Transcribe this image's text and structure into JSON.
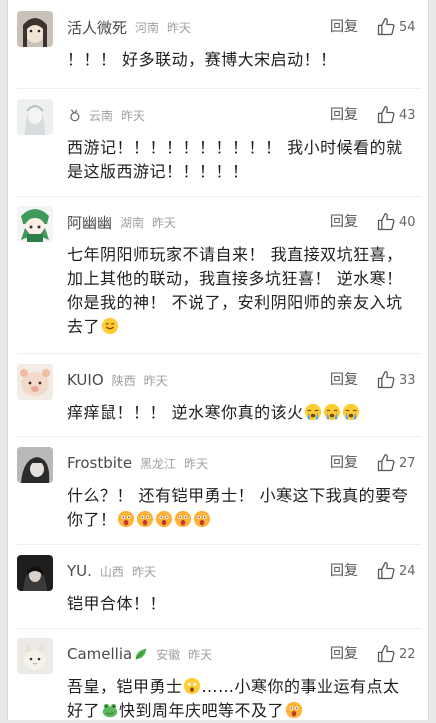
{
  "comments": [
    {
      "username": "活人微死",
      "location": "河南",
      "time": "昨天",
      "reply": "回复",
      "likes": "54",
      "lines": [
        "！！！ 好多联动，赛博大宋启动！！"
      ]
    },
    {
      "username": "",
      "location": "云南",
      "time": "昨天",
      "reply": "回复",
      "likes": "43",
      "lines": [
        "西游记！！！！！！！！！！ 我小时候看的就",
        "是这版西游记！！！！！"
      ]
    },
    {
      "username": "阿幽幽",
      "location": "湖南",
      "time": "昨天",
      "reply": "回复",
      "likes": "40",
      "lines": [
        "七年阴阳师玩家不请自来！ 我直接双坑狂喜，",
        "加上其他的联动，我直接多坑狂喜！ 逆水寒！",
        "你是我的神！ 不说了，安利阴阳师的亲友入坑",
        "去了"
      ]
    },
    {
      "username": "KUIO",
      "location": "陕西",
      "time": "昨天",
      "reply": "回复",
      "likes": "33",
      "lines": [
        "痒痒鼠！！！ 逆水寒你真的该火"
      ]
    },
    {
      "username": "Frostbite",
      "location": "黑龙江",
      "time": "昨天",
      "reply": "回复",
      "likes": "27",
      "lines": [
        "什么？！ 还有铠甲勇士！ 小寒这下我真的要夸",
        "你了！"
      ]
    },
    {
      "username": "YU.",
      "location": "山西",
      "time": "昨天",
      "reply": "回复",
      "likes": "24",
      "lines": [
        "铠甲合体！！"
      ]
    },
    {
      "username": "Camellia",
      "location": "安徽",
      "time": "昨天",
      "reply": "回复",
      "likes": "22",
      "lines": [
        "吾皇，铠甲勇士",
        "……小寒你的事业运有点太",
        "好了",
        "快到周年庆吧等不及了"
      ]
    }
  ],
  "colors": {
    "username": "#4a4a4a",
    "meta": "#a0a0a0",
    "text": "#1e1e1e",
    "divider": "#eeeeee"
  },
  "icons": [
    "thumbs-up-icon",
    "smile-emoji",
    "crying-emoji",
    "shocked-emoji",
    "leaf-icon",
    "frog-emoji"
  ]
}
